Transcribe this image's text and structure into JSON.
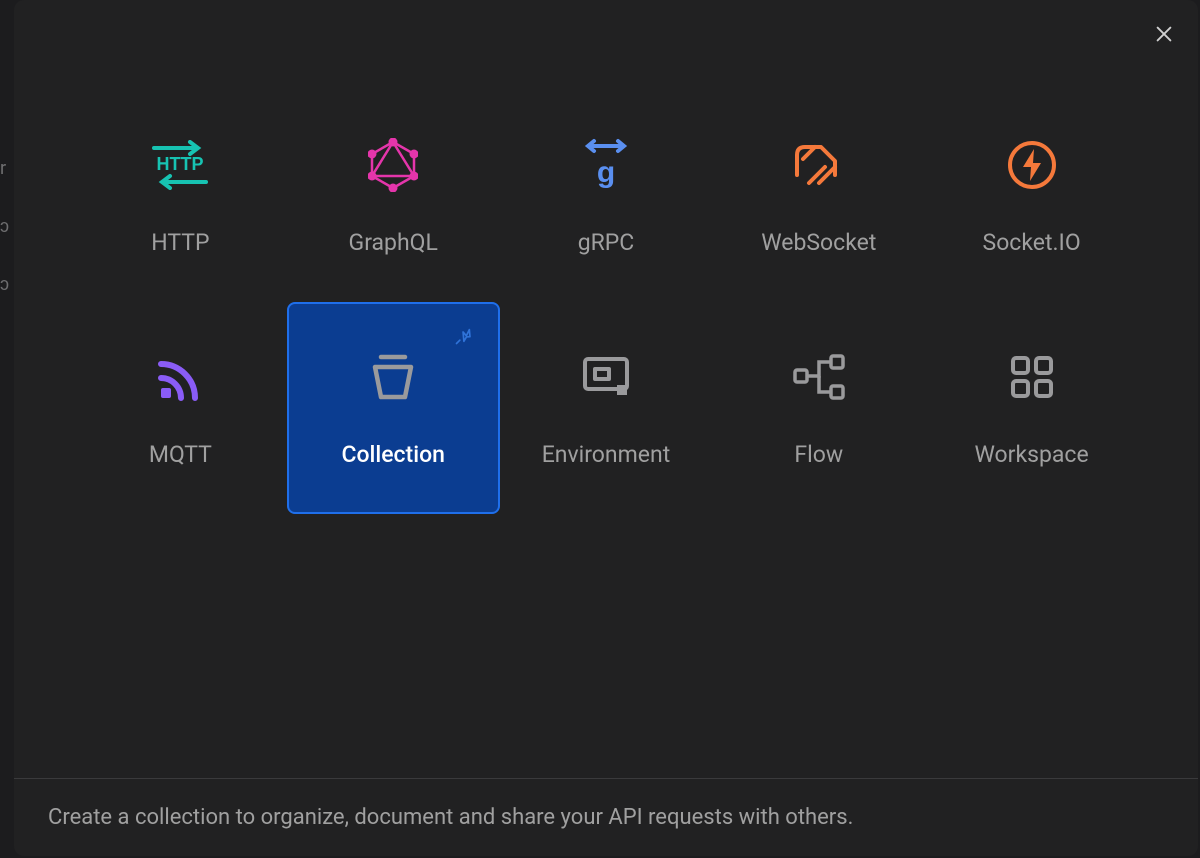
{
  "tiles": [
    {
      "id": "http",
      "label": "HTTP",
      "icon": "http-icon"
    },
    {
      "id": "graphql",
      "label": "GraphQL",
      "icon": "graphql-icon"
    },
    {
      "id": "grpc",
      "label": "gRPC",
      "icon": "grpc-icon"
    },
    {
      "id": "websocket",
      "label": "WebSocket",
      "icon": "websocket-icon"
    },
    {
      "id": "socketio",
      "label": "Socket.IO",
      "icon": "socketio-icon"
    },
    {
      "id": "mqtt",
      "label": "MQTT",
      "icon": "mqtt-icon"
    },
    {
      "id": "collection",
      "label": "Collection",
      "icon": "collection-icon",
      "selected": true,
      "pinned": true
    },
    {
      "id": "environment",
      "label": "Environment",
      "icon": "environment-icon"
    },
    {
      "id": "flow",
      "label": "Flow",
      "icon": "flow-icon"
    },
    {
      "id": "workspace",
      "label": "Workspace",
      "icon": "workspace-icon"
    }
  ],
  "footer_text": "Create a collection to organize, document and share your API requests with others.",
  "colors": {
    "http": "#17c3b2",
    "graphql": "#e535ab",
    "grpc": "#5a8ff0",
    "websocket": "#f5793b",
    "socketio": "#f5793b",
    "mqtt": "#8a5cf6",
    "neutral": "#9a9a9c",
    "selected_bg": "#0b3d91",
    "selected_border": "#1f6feb"
  }
}
